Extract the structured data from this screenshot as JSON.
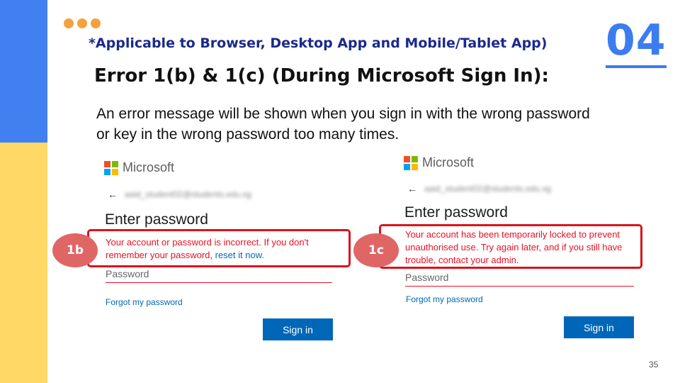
{
  "subtitle": "*Applicable to Browser, Desktop App and Mobile/Tablet App)",
  "slide_number": "04",
  "heading": "Error 1(b) & 1(c) (During Microsoft Sign In):",
  "body_text": "An error message will be shown when you sign in with the wrong password or key in the wrong password too many times.",
  "page_number": "35",
  "colors": {
    "blue_bar": "#4080f0",
    "yellow_bar": "#ffd866",
    "dots": "#f5a23c",
    "accent_blue": "#3b7df0",
    "error_red": "#d9141e",
    "badge": "#e06666",
    "ms_blue": "#0067b8"
  },
  "panels": [
    {
      "badge": "1b",
      "brand": "Microsoft",
      "email": "aaid_student02@students.edu.sg",
      "title": "Enter password",
      "error_text": "Your account or password is incorrect. If you don't remember your password, ",
      "error_link": "reset it now.",
      "password_placeholder": "Password",
      "forgot_link": "Forgot my password",
      "signin_label": "Sign in"
    },
    {
      "badge": "1c",
      "brand": "Microsoft",
      "email": "aaid_student02@students.edu.sg",
      "title": "Enter password",
      "error_text": "Your account has been temporarily locked to prevent unauthorised use. Try again later, and if you still have trouble, contact your admin.",
      "password_placeholder": "Password",
      "forgot_link": "Forgot my password",
      "signin_label": "Sign in"
    }
  ]
}
